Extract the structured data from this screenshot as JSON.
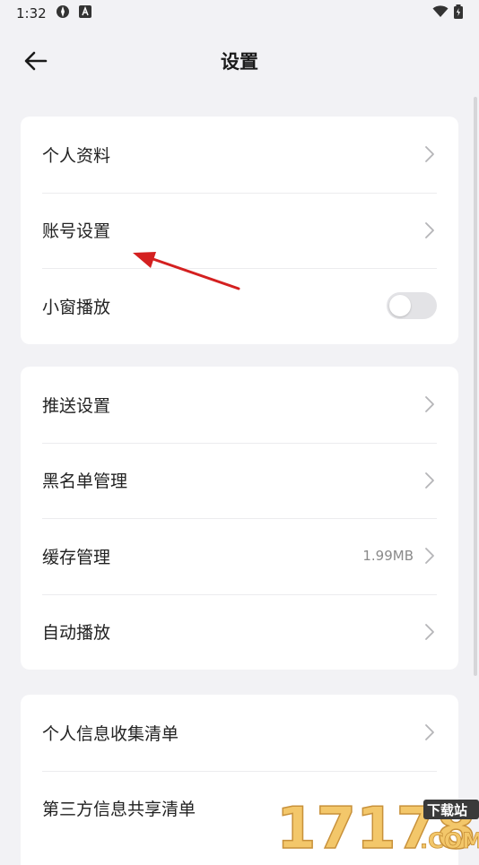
{
  "status_bar": {
    "time": "1:32"
  },
  "header": {
    "title": "设置"
  },
  "group1": {
    "items": [
      {
        "label": "个人资料"
      },
      {
        "label": "账号设置"
      },
      {
        "label": "小窗播放"
      }
    ],
    "mini_window_enabled": false
  },
  "group2": {
    "items": [
      {
        "label": "推送设置"
      },
      {
        "label": "黑名单管理"
      },
      {
        "label": "缓存管理",
        "value": "1.99MB"
      },
      {
        "label": "自动播放"
      }
    ]
  },
  "group3": {
    "items": [
      {
        "label": "个人信息收集清单"
      },
      {
        "label": "第三方信息共享清单"
      }
    ]
  },
  "watermark": {
    "brand": "17178",
    "tag": "下载站",
    "domain": ".COM"
  },
  "colors": {
    "annotation_arrow": "#d42020",
    "background": "#f2f2f5",
    "card": "#ffffff"
  }
}
